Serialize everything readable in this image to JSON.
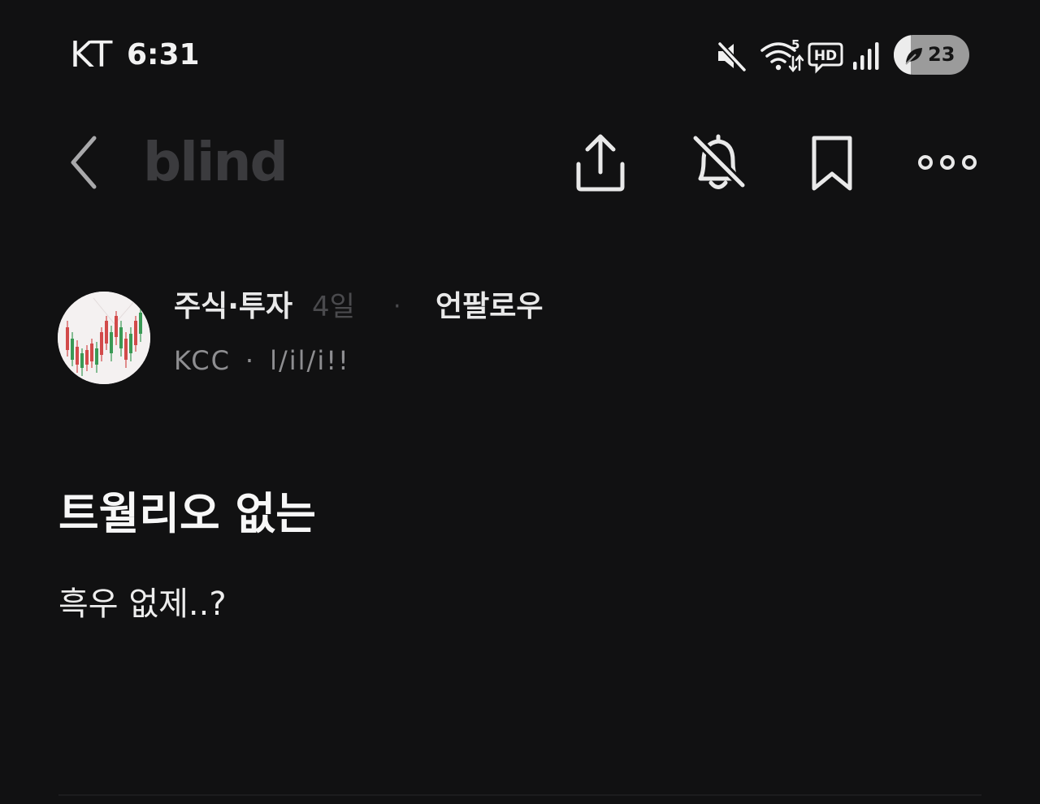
{
  "status_bar": {
    "carrier": "KT",
    "time": "6:31",
    "icons": [
      "mute-icon",
      "wifi-icon",
      "hd-voice-icon",
      "signal-icon"
    ],
    "wifi_generation": "5",
    "hd_label": "HD",
    "battery_label": "23",
    "battery_percent": 23
  },
  "app_bar": {
    "logo": "blind",
    "actions": [
      "back-icon",
      "share-icon",
      "notifications-off-icon",
      "bookmark-icon",
      "more-icon"
    ]
  },
  "post": {
    "category": "주식·투자",
    "time_ago": "4일",
    "meta_separator": "·",
    "follow_label": "언팔로우",
    "company": "KCC",
    "author_separator": "·",
    "nickname": "l/il/i!!",
    "title": "트월리오 없는",
    "body": "흑우 없제..?"
  },
  "colors": {
    "background": "#111112",
    "text_primary": "#ffffff",
    "text_secondary": "#8e8e91",
    "text_muted": "#4a4a4d",
    "logo": "#3b3b3e",
    "candle_red": "#d24a4a",
    "candle_green": "#3a9a55"
  }
}
